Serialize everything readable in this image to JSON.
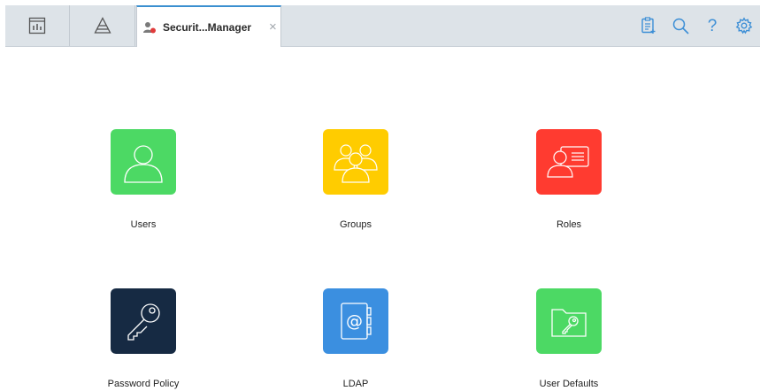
{
  "tabs": {
    "active_label": "Securit...Manager",
    "close_symbol": "×"
  },
  "toolbar": {
    "help_label": "?"
  },
  "tiles": [
    {
      "label": "Users",
      "color": "#4cd964",
      "icon": "user-icon"
    },
    {
      "label": "Groups",
      "color": "#ffcc00",
      "icon": "group-icon"
    },
    {
      "label": "Roles",
      "color": "#ff3b30",
      "icon": "role-card-icon"
    },
    {
      "label": "Password Policy",
      "color": "#162a43",
      "icon": "key-icon"
    },
    {
      "label": "LDAP",
      "color": "#3b8fe0",
      "icon": "address-book-icon"
    },
    {
      "label": "User Defaults",
      "color": "#4cd964",
      "icon": "folder-key-icon"
    }
  ],
  "colors": {
    "toolbar_bg": "#dde3e8",
    "accent": "#3b8fd0",
    "icon_blue": "#3d8fd6"
  }
}
